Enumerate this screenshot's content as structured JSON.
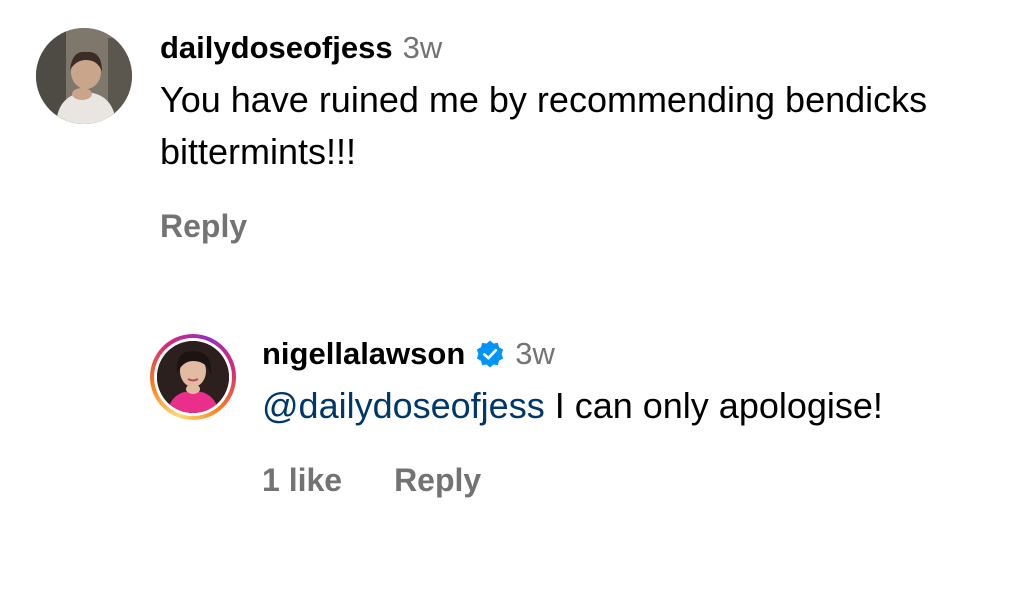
{
  "comments": [
    {
      "username": "dailydoseofjess",
      "time": "3w",
      "text": "You have ruined me by recommending bendicks bittermints!!!",
      "actions": {
        "reply": "Reply"
      },
      "avatar_icon": "profile-photo"
    },
    {
      "username": "nigellalawson",
      "verified_icon": "verified-badge-icon",
      "time": "3w",
      "mention": "@dailydoseofjess",
      "text": "I can only apologise!",
      "actions": {
        "likes": "1 like",
        "reply": "Reply"
      },
      "avatar_icon": "profile-photo",
      "story_ring": true
    }
  ],
  "colors": {
    "secondary_text": "#737373",
    "mention": "#00376b",
    "verified": "#0095f6"
  }
}
